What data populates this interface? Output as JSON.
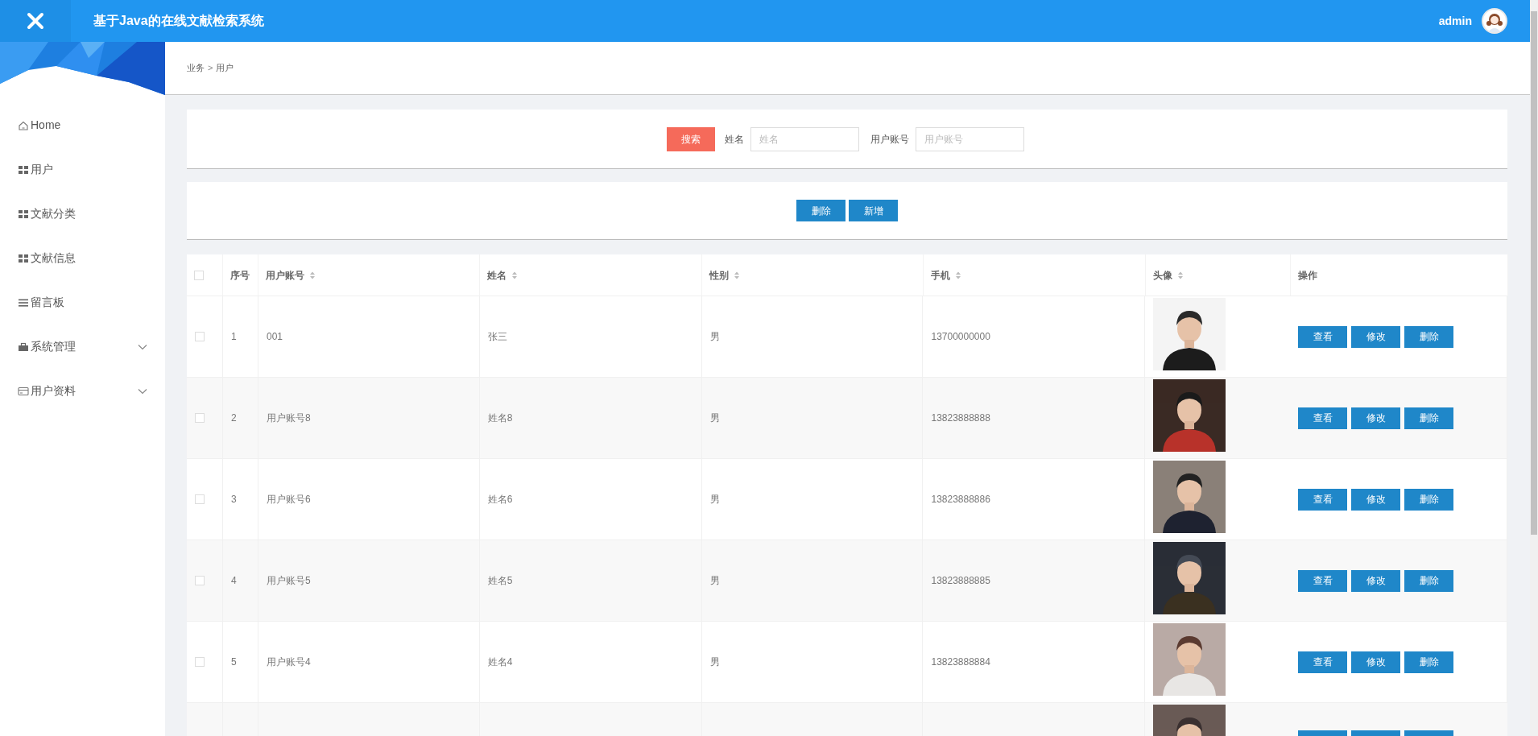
{
  "header": {
    "title": "基于Java的在线文献检索系统",
    "user": "admin"
  },
  "sidebar": {
    "items": [
      {
        "label": "Home",
        "kind": "home",
        "expandable": false
      },
      {
        "label": "用户",
        "kind": "grid",
        "expandable": false
      },
      {
        "label": "文献分类",
        "kind": "grid",
        "expandable": false
      },
      {
        "label": "文献信息",
        "kind": "grid",
        "expandable": false
      },
      {
        "label": "留言板",
        "kind": "list",
        "expandable": false
      },
      {
        "label": "系统管理",
        "kind": "briefcase",
        "expandable": true
      },
      {
        "label": "用户资料",
        "kind": "card",
        "expandable": true
      }
    ]
  },
  "breadcrumb": {
    "items": [
      "业务",
      "用户"
    ],
    "separator": ">"
  },
  "search": {
    "button": "搜索",
    "fields": [
      {
        "label": "姓名",
        "placeholder": "姓名"
      },
      {
        "label": "用户账号",
        "placeholder": "用户账号"
      }
    ]
  },
  "actions": [
    "删除",
    "新增"
  ],
  "table": {
    "header_checked": false,
    "columns": [
      {
        "label": "序号",
        "sortable": false
      },
      {
        "label": "用户账号",
        "sortable": true
      },
      {
        "label": "姓名",
        "sortable": true
      },
      {
        "label": "性别",
        "sortable": true
      },
      {
        "label": "手机",
        "sortable": true
      },
      {
        "label": "头像",
        "sortable": true
      },
      {
        "label": "操作",
        "sortable": false
      }
    ],
    "rows": [
      {
        "kind": "full",
        "checked": false,
        "cells": [
          "1",
          "001",
          "张三",
          "男",
          "13700000000"
        ],
        "actions": [
          "查看",
          "修改",
          "删除"
        ]
      },
      {
        "kind": "full",
        "checked": false,
        "cells": [
          "2",
          "用户账号8",
          "姓名8",
          "男",
          "13823888888"
        ],
        "actions": [
          "查看",
          "修改",
          "删除"
        ]
      },
      {
        "kind": "full",
        "checked": false,
        "cells": [
          "3",
          "用户账号6",
          "姓名6",
          "男",
          "13823888886"
        ],
        "actions": [
          "查看",
          "修改",
          "删除"
        ]
      },
      {
        "kind": "full",
        "checked": false,
        "cells": [
          "4",
          "用户账号5",
          "姓名5",
          "男",
          "13823888885"
        ],
        "actions": [
          "查看",
          "修改",
          "删除"
        ]
      },
      {
        "kind": "full",
        "checked": false,
        "cells": [
          "5",
          "用户账号4",
          "姓名4",
          "男",
          "13823888884"
        ],
        "actions": [
          "查看",
          "修改",
          "删除"
        ]
      },
      {
        "kind": "cut"
      }
    ]
  }
}
